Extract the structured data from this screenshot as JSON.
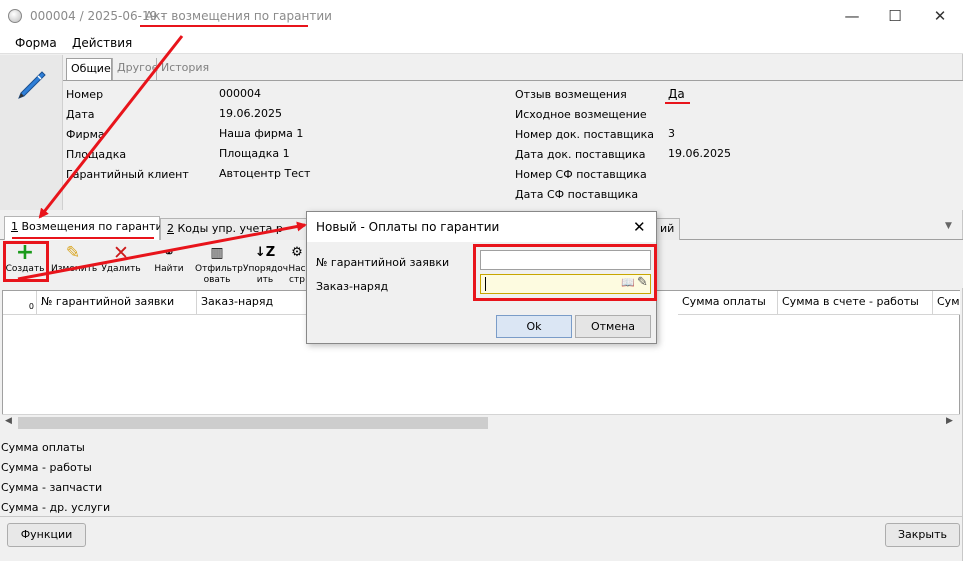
{
  "window": {
    "title_number": "000004 / 2025-06-19 -",
    "title_name": "Акт возмещения по гарантии",
    "minimize": "—",
    "maximize": "☐",
    "close": "✕"
  },
  "menu": [
    "Форма",
    "Действия"
  ],
  "subtabs": [
    "Общие",
    "Другое",
    "История"
  ],
  "left_fields": [
    {
      "label": "Номер",
      "value": "000004"
    },
    {
      "label": "Дата",
      "value": "19.06.2025"
    },
    {
      "label": "Фирма",
      "value": "Наша фирма 1"
    },
    {
      "label": "Площадка",
      "value": "Площадка 1"
    },
    {
      "label": "Гарантийный клиент",
      "value": "Автоцентр Тест"
    }
  ],
  "right_fields": [
    {
      "label": "Отзыв возмещения",
      "value": "Да"
    },
    {
      "label": "Исходное возмещение",
      "value": ""
    },
    {
      "label": "Номер док. поставщика",
      "value": "3"
    },
    {
      "label": "Дата док. поставщика",
      "value": "19.06.2025"
    },
    {
      "label": "Номер СФ поставщика",
      "value": ""
    },
    {
      "label": "Дата СФ поставщика",
      "value": ""
    }
  ],
  "main_tabs": {
    "tab1_num": "1",
    "tab1_label": " Возмещения по гарантии",
    "tab2_num": "2",
    "tab2_label": " Коды упр. учета р",
    "tab3_fragment": "ий"
  },
  "toolbar": [
    {
      "label": "Создать",
      "icon": "plus-icon"
    },
    {
      "label": "Изменить",
      "icon": "pencil-icon"
    },
    {
      "label": "Удалить",
      "icon": "delete-x-icon"
    },
    {
      "label": "Найти",
      "icon": "binoculars-icon"
    },
    {
      "label": "Отфильтровать",
      "icon": "filter-icon"
    },
    {
      "label": "Упорядочить",
      "icon": "sort-az-icon"
    },
    {
      "label": "Настр ст",
      "icon": "settings-icon"
    }
  ],
  "toolbar_label_lines": {
    "filter_1": "Отфильтр",
    "filter_2": "овать",
    "sort_1": "Упорядоч",
    "sort_2": "ить",
    "settings_1": "Нас",
    "settings_2": "стр"
  },
  "grid": {
    "row_count": "0",
    "columns": [
      "№ гарантийной заявки",
      "Заказ-наряд",
      "Сумма оплаты",
      "Сумма в счете - работы",
      "Сум"
    ]
  },
  "totals": [
    "Сумма оплаты",
    "Сумма - работы",
    "Сумма - запчасти",
    "Сумма - др. услуги"
  ],
  "buttons": {
    "functions": "Функции",
    "close": "Закрыть"
  },
  "dialog": {
    "title": "Новый - Оплаты по гарантии",
    "close": "✕",
    "field1_label": "№ гарантийной заявки",
    "field1_value": "",
    "field2_label": "Заказ-наряд",
    "field2_value": "",
    "ok": "Ok",
    "cancel": "Отмена"
  },
  "colors": {
    "annotation": "#e8141b",
    "accent": "#1e5fb4"
  }
}
